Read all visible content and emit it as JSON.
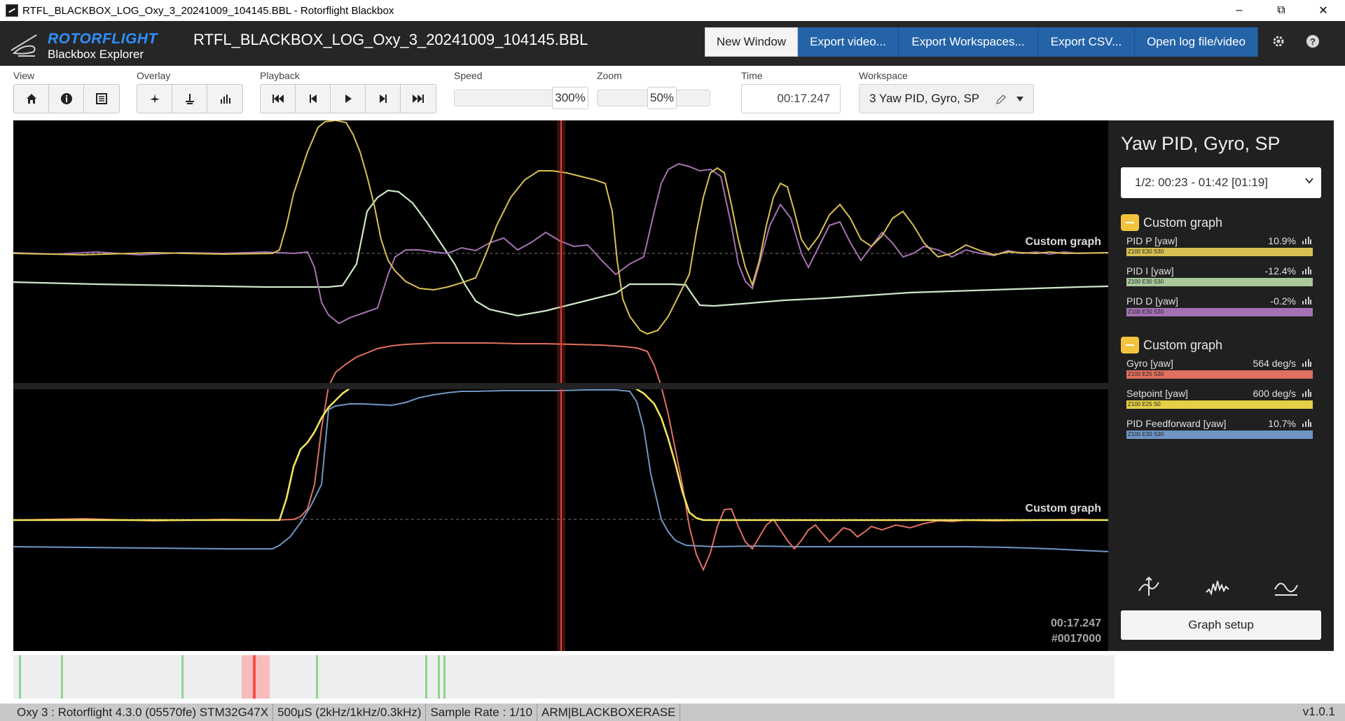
{
  "window": {
    "title": "RTFL_BLACKBOX_LOG_Oxy_3_20241009_104145.BBL - Rotorflight Blackbox",
    "minimize": "–",
    "maximize": "⧉",
    "close": "✕"
  },
  "header": {
    "logo_main": "ROTORFLIGHT",
    "logo_sub": "Blackbox Explorer",
    "log_file": "RTFL_BLACKBOX_LOG_Oxy_3_20241009_104145.BBL",
    "buttons": {
      "new_window": "New Window",
      "export_video": "Export video...",
      "export_workspaces": "Export Workspaces...",
      "export_csv": "Export CSV...",
      "open_log": "Open log file/video"
    },
    "icons": [
      "gear-icon",
      "help-icon"
    ]
  },
  "toolbar": {
    "view_label": "View",
    "overlay_label": "Overlay",
    "playback_label": "Playback",
    "speed_label": "Speed",
    "speed_value": "300%",
    "zoom_label": "Zoom",
    "zoom_value": "50%",
    "time_label": "Time",
    "time_value": "00:17.247",
    "workspace_label": "Workspace",
    "workspace_value": "3 Yaw PID, Gyro, SP"
  },
  "graph": {
    "top_label": "Custom graph",
    "bottom_label": "Custom graph",
    "time": "00:17.247",
    "frame": "#0017000",
    "colors": {
      "yellow": "#d9c052",
      "green": "#cde8c6",
      "purple": "#a571b3",
      "red": "#e0705f",
      "yellow_bright": "#f2e35a",
      "blue": "#6f95c4",
      "cursor": "#e0423a"
    }
  },
  "legend": {
    "title": "Yaw PID, Gyro, SP",
    "range": "1/2: 00:23 - 01:42 [01:19]",
    "groups": [
      {
        "title": "Custom graph",
        "items": [
          {
            "name": "PID P [yaw]",
            "value": "10.9%",
            "bar": "Z100 E30 S30",
            "color": "#d9c052"
          },
          {
            "name": "PID I [yaw]",
            "value": "-12.4%",
            "bar": "Z100 E30 S30",
            "color": "#a9c99b"
          },
          {
            "name": "PID D [yaw]",
            "value": "-0.2%",
            "bar": "Z100 E30 S30",
            "color": "#a571b3"
          }
        ]
      },
      {
        "title": "Custom graph",
        "items": [
          {
            "name": "Gyro [yaw]",
            "value": "564 deg/s",
            "bar": "Z100 E25 S30",
            "color": "#e0705f"
          },
          {
            "name": "Setpoint [yaw]",
            "value": "600 deg/s",
            "bar": "Z100 E25 S0",
            "color": "#e4cf45"
          },
          {
            "name": "PID Feedforward [yaw]",
            "value": "10.7%",
            "bar": "Z100 E30 S30",
            "color": "#6f95c4"
          }
        ]
      }
    ],
    "graph_setup": "Graph setup"
  },
  "statusbar": {
    "device": "Oxy 3 : Rotorflight 4.3.0 (05570fe) STM32G47X",
    "loop": "500μS (2kHz/1kHz/0.3kHz)",
    "sample_rate": "Sample Rate : 1/10",
    "flags": "ARM|BLACKBOXERASE",
    "version": "v1.0.1"
  }
}
